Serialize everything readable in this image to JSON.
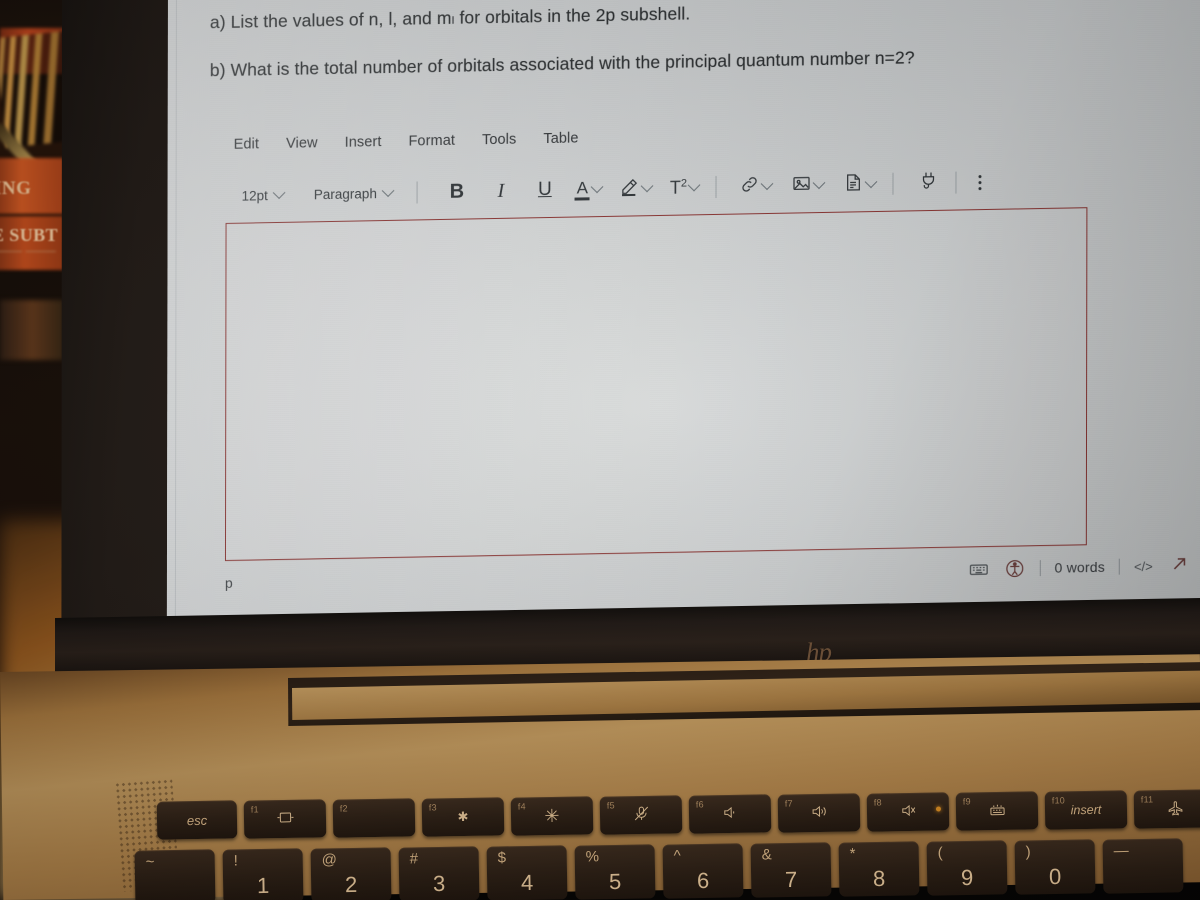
{
  "document": {
    "questions": [
      "a) List the values of n, l, and mₗ for orbitals in the 2p subshell.",
      "b) What is the total number of orbitals associated with the principal quantum number n=2?"
    ]
  },
  "editor": {
    "menubar": [
      {
        "label": "Edit",
        "name": "menu-edit"
      },
      {
        "label": "View",
        "name": "menu-view"
      },
      {
        "label": "Insert",
        "name": "menu-insert"
      },
      {
        "label": "Format",
        "name": "menu-format"
      },
      {
        "label": "Tools",
        "name": "menu-tools"
      },
      {
        "label": "Table",
        "name": "menu-table"
      }
    ],
    "toolbar": {
      "font_size": "12pt",
      "block_format": "Paragraph",
      "bold_label": "B",
      "italic_label": "I",
      "underline_label": "U",
      "text_color_label": "A",
      "superscript_label": "T",
      "superscript_exponent": "2"
    },
    "body_text": "",
    "statusbar": {
      "path": "p",
      "word_count": "0 words",
      "code_label": "</>"
    }
  },
  "laptop": {
    "brand": "hp",
    "keyboard": {
      "function_row": [
        {
          "key": "esc",
          "fn": "",
          "glyph": "esc",
          "icon": "escape-key"
        },
        {
          "key": "",
          "fn": "f1",
          "glyph": "□",
          "icon": "display-switch-icon"
        },
        {
          "key": "",
          "fn": "f2",
          "glyph": "",
          "icon": "blank-key"
        },
        {
          "key": "",
          "fn": "f3",
          "glyph": "☀",
          "icon": "brightness-down-icon"
        },
        {
          "key": "",
          "fn": "f4",
          "glyph": "☀",
          "icon": "brightness-up-icon"
        },
        {
          "key": "",
          "fn": "f5",
          "glyph": "",
          "icon": "mic-mute-icon"
        },
        {
          "key": "",
          "fn": "f6",
          "glyph": "",
          "icon": "volume-down-icon"
        },
        {
          "key": "",
          "fn": "f7",
          "glyph": "",
          "icon": "volume-up-icon"
        },
        {
          "key": "",
          "fn": "f8",
          "glyph": "",
          "icon": "speaker-mute-icon"
        },
        {
          "key": "",
          "fn": "f9",
          "glyph": "",
          "icon": "keyboard-backlight-icon"
        },
        {
          "key": "insert",
          "fn": "f10",
          "glyph": "insert",
          "icon": "insert-key"
        },
        {
          "key": "",
          "fn": "f11",
          "glyph": "",
          "icon": "airplane-mode-icon"
        }
      ],
      "number_row": [
        {
          "primary": "",
          "shifted": "~",
          "icon": "tilde-key"
        },
        {
          "primary": "1",
          "shifted": "!",
          "icon": "one-key"
        },
        {
          "primary": "2",
          "shifted": "@",
          "icon": "two-key"
        },
        {
          "primary": "3",
          "shifted": "#",
          "icon": "three-key"
        },
        {
          "primary": "4",
          "shifted": "$",
          "icon": "four-key"
        },
        {
          "primary": "5",
          "shifted": "%",
          "icon": "five-key"
        },
        {
          "primary": "6",
          "shifted": "^",
          "icon": "six-key"
        },
        {
          "primary": "7",
          "shifted": "&",
          "icon": "seven-key"
        },
        {
          "primary": "8",
          "shifted": "*",
          "icon": "eight-key"
        },
        {
          "primary": "9",
          "shifted": "(",
          "icon": "nine-key"
        },
        {
          "primary": "0",
          "shifted": ")",
          "icon": "zero-key"
        },
        {
          "primary": "",
          "shifted": "—",
          "icon": "minus-key"
        }
      ]
    }
  },
  "background": {
    "book_spine_1": "ING",
    "book_spine_2": "E SUBT",
    "book_spine_2b": "—— ——"
  },
  "colors": {
    "editor_border": "#8c3030",
    "screen_bg": "#d9dde0",
    "text": "#23282c",
    "laptop_body": "#c39a5e",
    "key_cap": "#2a1d13",
    "key_text": "#e8c79a",
    "led_amber": "#e09020"
  }
}
